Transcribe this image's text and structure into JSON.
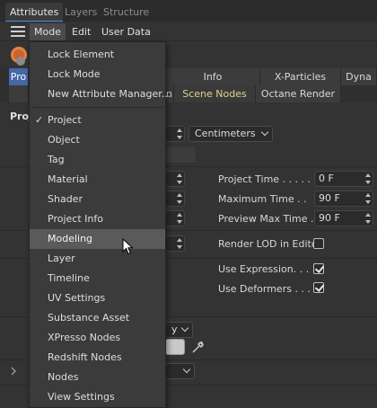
{
  "top_tabs": [
    "Attributes",
    "Layers",
    "Structure"
  ],
  "menubar": {
    "items": [
      "Mode",
      "Edit",
      "User Data"
    ]
  },
  "background": {
    "tabs_row1": [
      "Pro",
      "",
      "Info",
      "X-Particles",
      "Dyna"
    ],
    "tabs_row2": [
      "n",
      "Scene Nodes",
      "Octane Render"
    ],
    "section": "Proj",
    "units_dropdown": "Centimeters",
    "fields": [
      {
        "label": "Project Time . . . . .",
        "value": "0 F"
      },
      {
        "label": "Maximum Time . .",
        "value": "90 F"
      },
      {
        "label": "Preview Max Time .",
        "value": "90 F"
      }
    ],
    "render_lod_label": "Render LOD in Editor",
    "use_expression_label": "Use Expression. . . .",
    "use_deformers_label": "Use Deformers . . . .",
    "misc_dropdown_text": "y"
  },
  "mode_menu": {
    "items": [
      {
        "label": "Lock Element"
      },
      {
        "label": "Lock Mode"
      },
      {
        "label": "New Attribute Manager..."
      },
      {
        "label": "Project",
        "checked": true
      },
      {
        "label": "Object"
      },
      {
        "label": "Tag"
      },
      {
        "label": "Material"
      },
      {
        "label": "Shader"
      },
      {
        "label": "Project Info"
      },
      {
        "label": "Modeling",
        "hover": true
      },
      {
        "label": "Layer"
      },
      {
        "label": "Timeline"
      },
      {
        "label": "UV Settings"
      },
      {
        "label": "Substance Asset"
      },
      {
        "label": "XPresso Nodes"
      },
      {
        "label": "Redshift Nodes"
      },
      {
        "label": "Nodes"
      },
      {
        "label": "View Settings"
      }
    ],
    "check_glyph": "✓"
  }
}
